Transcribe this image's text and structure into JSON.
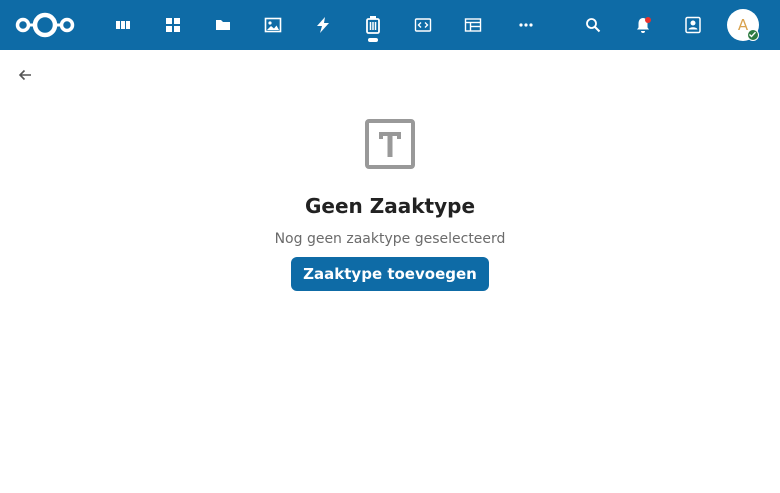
{
  "colors": {
    "brand": "#0e6ba6",
    "text": "#222222",
    "muted": "#6b6b6b",
    "icon": "#999999",
    "notification": "#e9322d",
    "online": "#2d7b41"
  },
  "header": {
    "apps": [
      {
        "name": "dashboard",
        "icon": "dashboard-icon"
      },
      {
        "name": "apps-grid",
        "icon": "grid-icon"
      },
      {
        "name": "files",
        "icon": "folder-icon"
      },
      {
        "name": "photos",
        "icon": "image-icon"
      },
      {
        "name": "activity",
        "icon": "lightning-icon"
      },
      {
        "name": "zaakafhandelapp",
        "icon": "archive-icon",
        "active": true
      },
      {
        "name": "developer",
        "icon": "code-icon"
      },
      {
        "name": "tables",
        "icon": "table-icon"
      },
      {
        "name": "more",
        "icon": "more-icon"
      }
    ],
    "right_icons": [
      "search-icon",
      "bell-icon",
      "contacts-icon"
    ],
    "avatar": {
      "letter": "A",
      "status": "online"
    }
  },
  "empty_state": {
    "icon": "text-box-icon",
    "title": "Geen Zaaktype",
    "description": "Nog geen zaaktype geselecteerd",
    "button_label": "Zaaktype toevoegen"
  }
}
